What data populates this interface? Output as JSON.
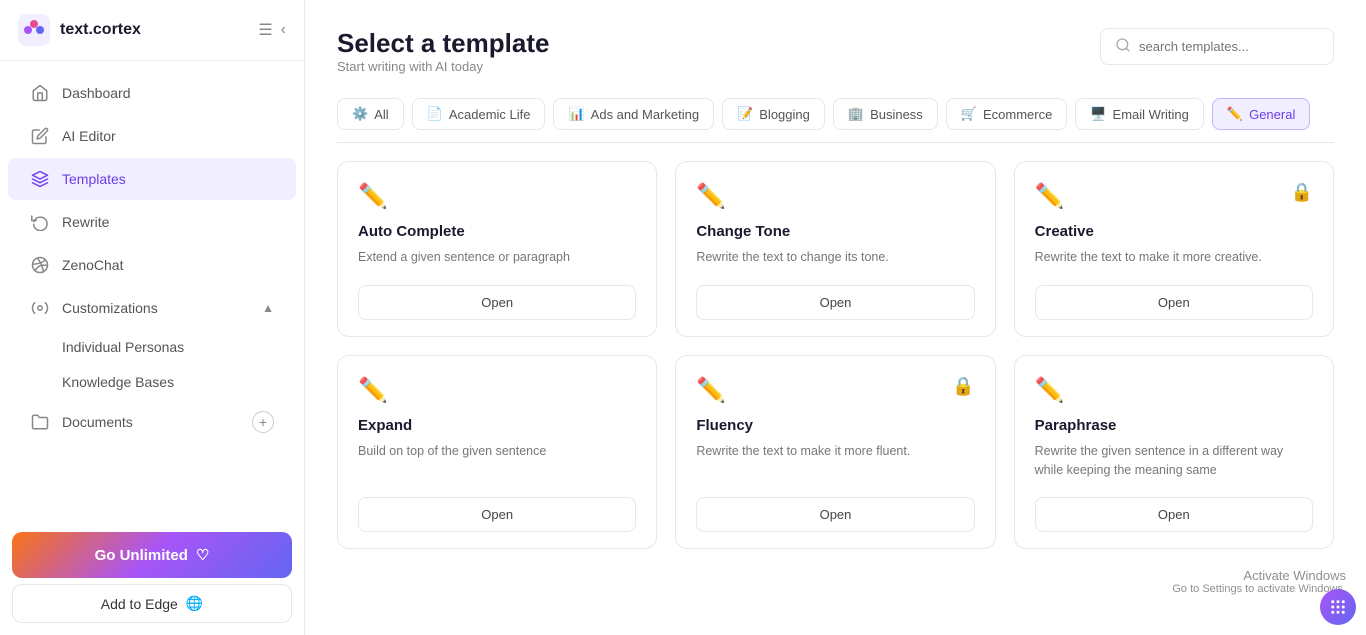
{
  "app": {
    "name": "text.cortex"
  },
  "sidebar": {
    "toggle_label": "☰",
    "collapse_label": "‹",
    "nav_items": [
      {
        "id": "dashboard",
        "label": "Dashboard",
        "icon": "home"
      },
      {
        "id": "ai-editor",
        "label": "AI Editor",
        "icon": "edit"
      },
      {
        "id": "templates",
        "label": "Templates",
        "icon": "layers",
        "active": true
      },
      {
        "id": "rewrite",
        "label": "Rewrite",
        "icon": "refresh"
      },
      {
        "id": "zenochat",
        "label": "ZenoChat",
        "icon": "chat"
      }
    ],
    "customizations_label": "Customizations",
    "individual_personas_label": "Individual Personas",
    "knowledge_bases_label": "Knowledge Bases",
    "documents_label": "Documents",
    "go_unlimited_label": "Go Unlimited",
    "add_to_edge_label": "Add to Edge"
  },
  "main": {
    "title": "Select a template",
    "subtitle": "Start writing with AI today",
    "search_placeholder": "search templates...",
    "tabs": [
      {
        "id": "all",
        "label": "All",
        "icon": "⚙️",
        "active": false
      },
      {
        "id": "academic-life",
        "label": "Academic Life",
        "icon": "📄"
      },
      {
        "id": "ads-marketing",
        "label": "Ads and Marketing",
        "icon": "📊"
      },
      {
        "id": "blogging",
        "label": "Blogging",
        "icon": "📝"
      },
      {
        "id": "business",
        "label": "Business",
        "icon": "🏢"
      },
      {
        "id": "ecommerce",
        "label": "Ecommerce",
        "icon": "🛒"
      },
      {
        "id": "email-writing",
        "label": "Email Writing",
        "icon": "🖥️"
      },
      {
        "id": "general",
        "label": "General",
        "icon": "✏️",
        "active": true
      }
    ],
    "cards": [
      {
        "id": "auto-complete",
        "title": "Auto Complete",
        "description": "Extend a given sentence or paragraph",
        "locked": false,
        "open_label": "Open"
      },
      {
        "id": "change-tone",
        "title": "Change Tone",
        "description": "Rewrite the text to change its tone.",
        "locked": false,
        "open_label": "Open"
      },
      {
        "id": "creative",
        "title": "Creative",
        "description": "Rewrite the text to make it more creative.",
        "locked": true,
        "open_label": "Open"
      },
      {
        "id": "expand",
        "title": "Expand",
        "description": "Build on top of the given sentence",
        "locked": false,
        "open_label": "Open"
      },
      {
        "id": "fluency",
        "title": "Fluency",
        "description": "Rewrite the text to make it more fluent.",
        "locked": true,
        "open_label": "Open"
      },
      {
        "id": "paraphrase",
        "title": "Paraphrase",
        "description": "Rewrite the given sentence in a different way while keeping the meaning same",
        "locked": false,
        "open_label": "Open"
      }
    ]
  },
  "activate_windows": {
    "title": "Activate Windows",
    "subtitle": "Go to Settings to activate Windows."
  }
}
